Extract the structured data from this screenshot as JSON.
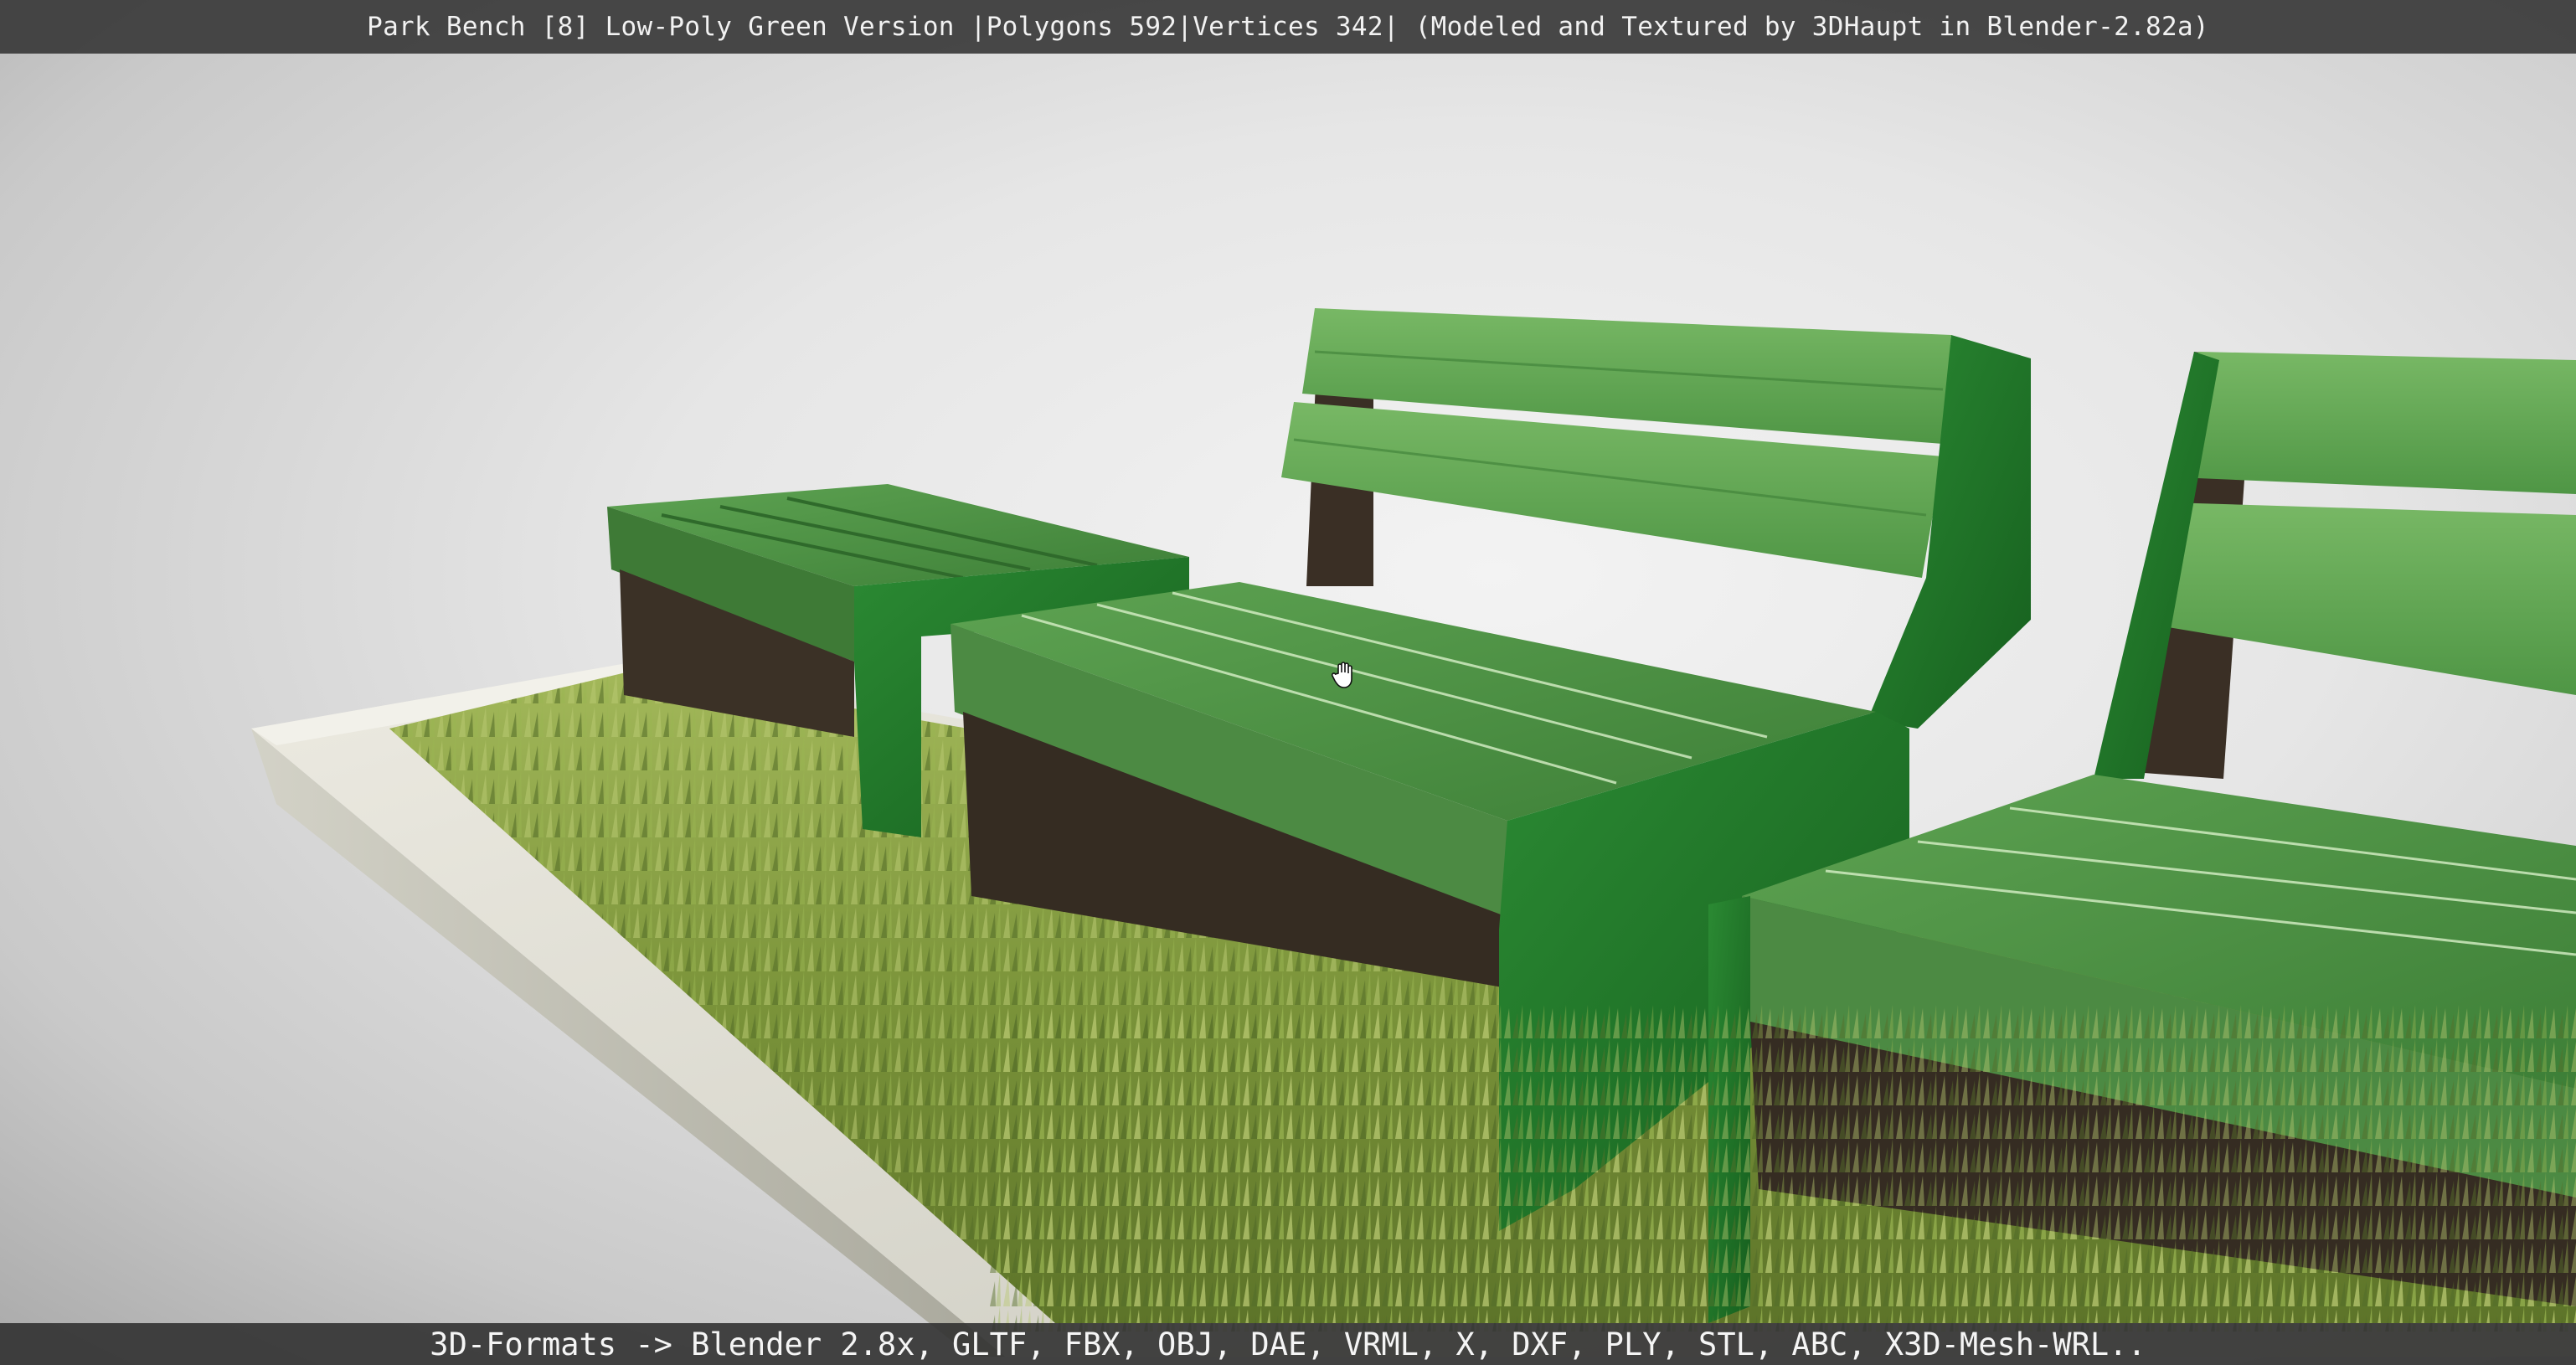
{
  "viewer": {
    "title": "Park Bench [8] Low-Poly Green Version |Polygons 592|Vertices 342| (Modeled and Textured by 3DHaupt in Blender-2.82a)",
    "formats": "3D-Formats -> Blender 2.8x, GLTF, FBX, OBJ, DAE, VRML, X, DXF, PLY, STL, ABC, X3D-Mesh-WRL.."
  },
  "colors": {
    "bench_green": "#3f8a3a",
    "bench_green_light": "#6db35a",
    "bench_frame": "#1f6e26",
    "grass": "#7d9a3a",
    "planter": "#d9d8ce",
    "bar_background": "#3a3a3a"
  },
  "icons": {
    "cursor": "hand-grab-cursor-icon"
  }
}
